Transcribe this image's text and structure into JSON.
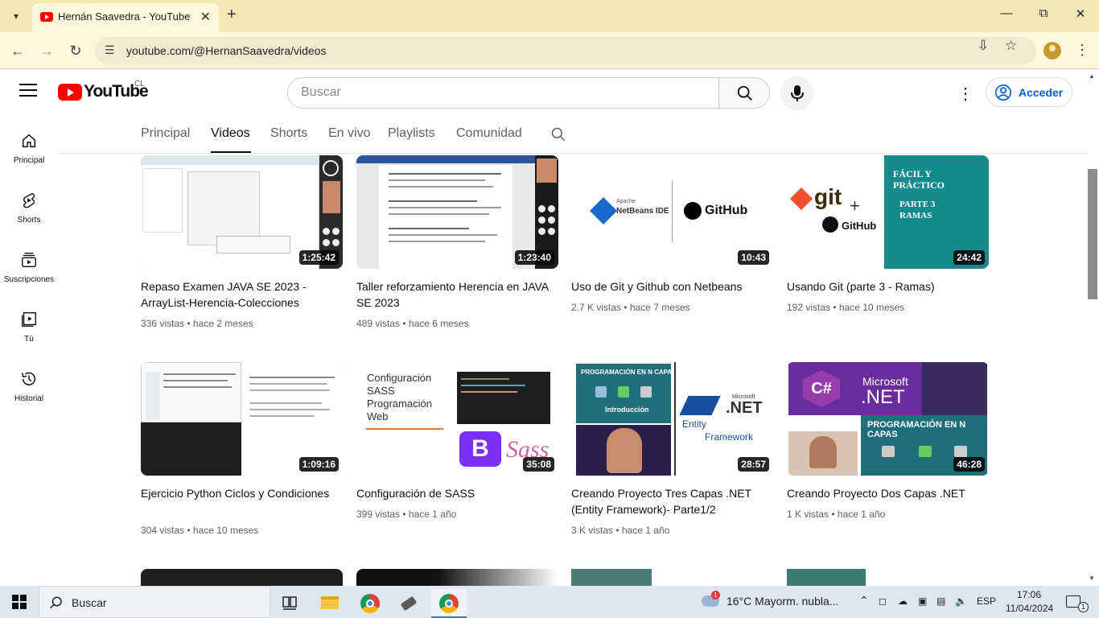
{
  "browser": {
    "tab_title": "Hernán Saavedra - YouTube",
    "url": "youtube.com/@HernanSaavedra/videos"
  },
  "youtube": {
    "logo_text": "YouTube",
    "country": "CL",
    "search_placeholder": "Buscar",
    "signin_label": "Acceder"
  },
  "sidebar": {
    "items": [
      {
        "label": "Principal",
        "icon": "home-icon"
      },
      {
        "label": "Shorts",
        "icon": "shorts-icon"
      },
      {
        "label": "Suscripciones",
        "icon": "subscriptions-icon"
      },
      {
        "label": "Tú",
        "icon": "you-icon"
      },
      {
        "label": "Historial",
        "icon": "history-icon"
      }
    ]
  },
  "channel_tabs": [
    "Principal",
    "Videos",
    "Shorts",
    "En vivo",
    "Playlists",
    "Comunidad"
  ],
  "active_tab": "Videos",
  "videos": [
    {
      "title": "Repaso Examen JAVA SE 2023 - ArrayList-Herencia-Colecciones",
      "views": "336 vistas",
      "age": "hace 2 meses",
      "duration": "1:25:42"
    },
    {
      "title": "Taller reforzamiento Herencia en JAVA SE 2023",
      "views": "489 vistas",
      "age": "hace 6 meses",
      "duration": "1:23:40"
    },
    {
      "title": "Uso de Git y Github con Netbeans",
      "views": "2.7 K vistas",
      "age": "hace 7 meses",
      "duration": "10:43"
    },
    {
      "title": "Usando Git (parte 3 - Ramas)",
      "views": "192 vistas",
      "age": "hace 10 meses",
      "duration": "24:42"
    },
    {
      "title": "Ejercicio Python Ciclos y Condiciones",
      "views": "304 vistas",
      "age": "hace 10 meses",
      "duration": "1:09:16"
    },
    {
      "title": "Configuración de SASS",
      "views": "399 vistas",
      "age": "hace 1 año",
      "duration": "35:08"
    },
    {
      "title": "Creando Proyecto Tres Capas .NET (Entity Framework)- Parte1/2",
      "views": "3 K vistas",
      "age": "hace 1 año",
      "duration": "28:57"
    },
    {
      "title": "Creando Proyecto Dos Capas .NET",
      "views": "1 K vistas",
      "age": "hace 1 año",
      "duration": "46:28"
    }
  ],
  "thumb_text": {
    "netbeans": "NetBeans IDE",
    "apache": "Apache",
    "github": "GitHub",
    "git": "git",
    "facil": "FÁCIL Y PRÁCTICO",
    "parte": "PARTE 3 RAMAS",
    "sass_lines": "Configuración SASS Programación Web",
    "sass_logo": "Sass",
    "ncapas": "PROGRAMACIÓN EN N CAPAS",
    "intro": "Introducción",
    "microsoft": "Microsoft",
    "dotnet": ".NET",
    "entity": "Entity",
    "framework": "Framework"
  },
  "taskbar": {
    "search_label": "Buscar",
    "weather": "16°C  Mayorm. nubla...",
    "lang": "ESP",
    "time": "17:06",
    "date": "11/04/2024",
    "notif_count": "1",
    "weather_badge": "1"
  }
}
